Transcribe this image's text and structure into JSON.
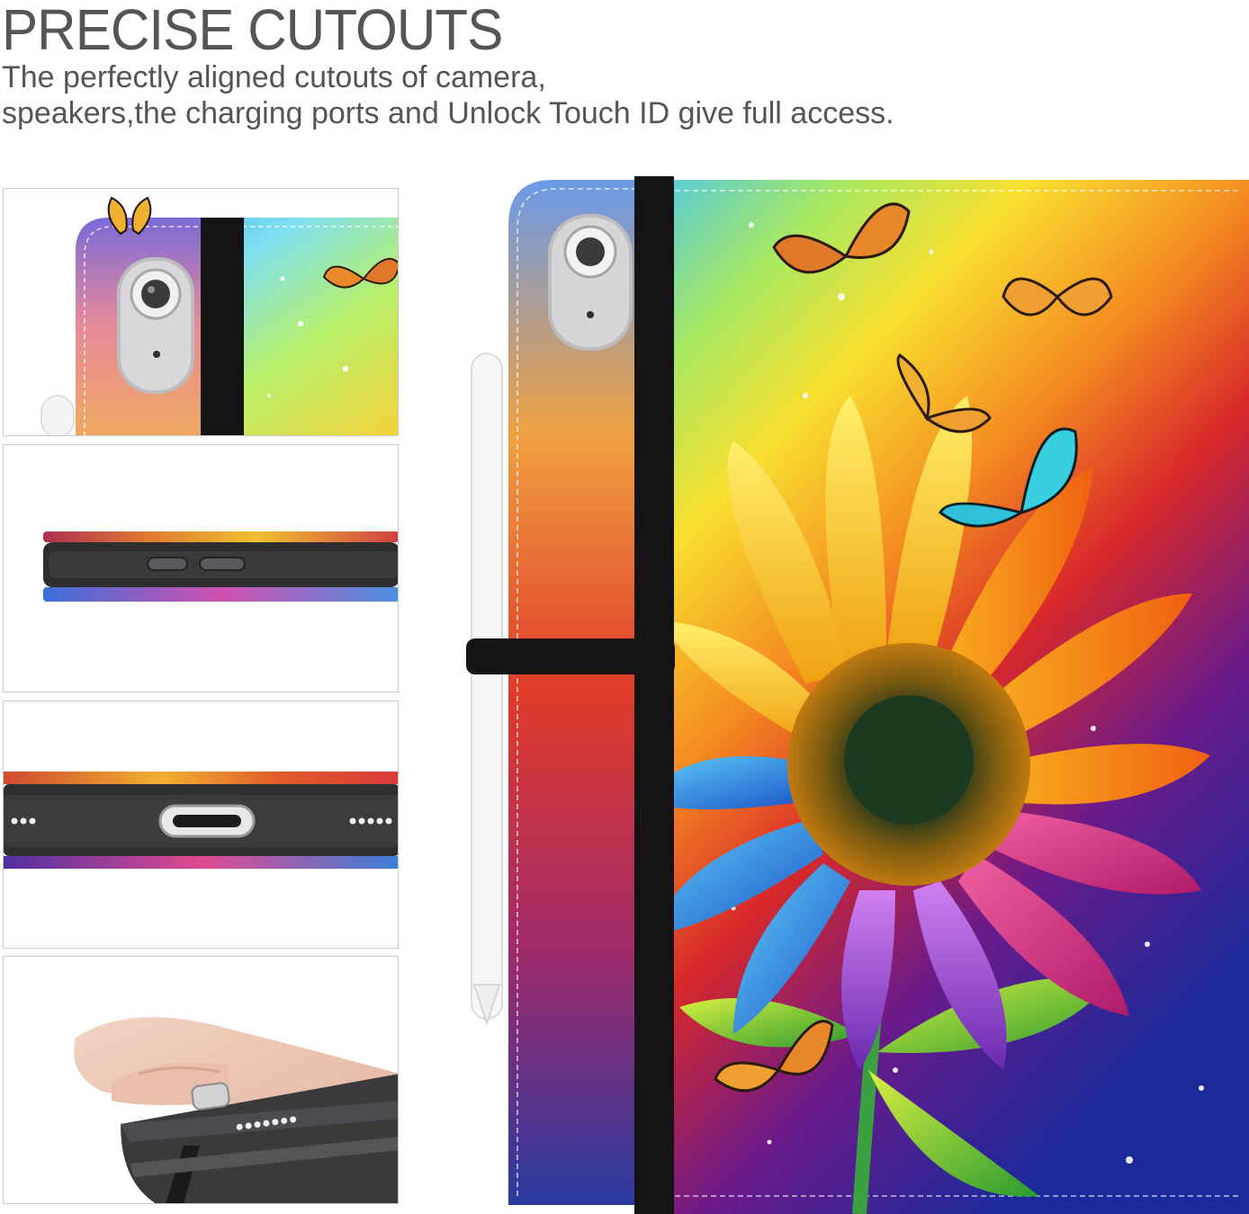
{
  "header": {
    "title": "PRECISE CUTOUTS",
    "subtitle_lines": [
      "The perfectly aligned cutouts of camera,",
      "speakers,the charging ports and Unlock Touch ID give full access."
    ]
  },
  "panels": [
    {
      "icon": "camera-cutout-closeup"
    },
    {
      "icon": "volume-buttons-cutout-closeup"
    },
    {
      "icon": "charging-port-speaker-cutout-closeup"
    },
    {
      "icon": "hand-holding-tablet-closeup"
    }
  ],
  "product": {
    "icon": "sunflower-butterfly-tablet-case"
  },
  "colors": {
    "text": "#555555",
    "panel_border": "#c9c9c9",
    "strap": "#111111",
    "case_body": "#3a3a3c"
  }
}
